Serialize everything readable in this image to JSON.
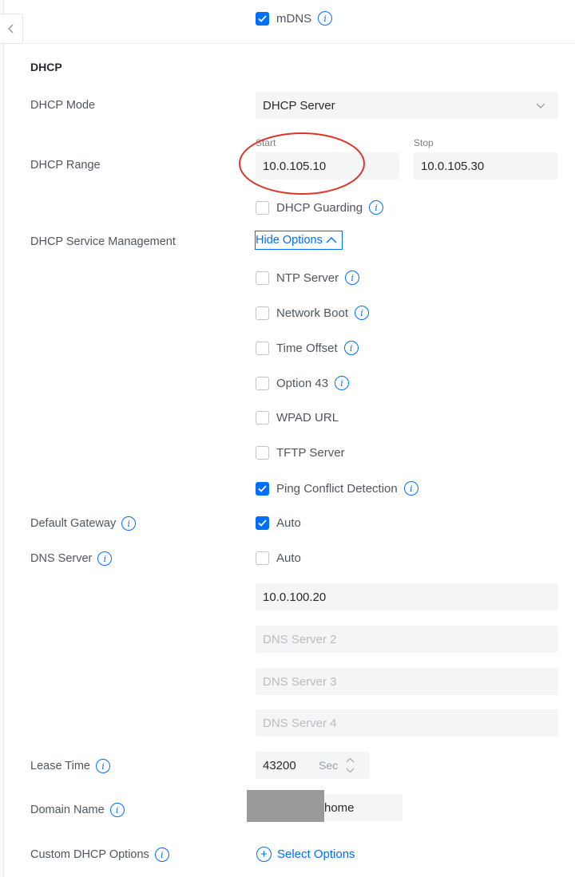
{
  "mdns": {
    "label": "mDNS",
    "checked": true
  },
  "section_title": "DHCP",
  "dhcp_mode": {
    "label": "DHCP Mode",
    "value": "DHCP Server"
  },
  "dhcp_range": {
    "label": "DHCP Range",
    "start_label": "Start",
    "start_value": "10.0.105.10",
    "stop_label": "Stop",
    "stop_value": "10.0.105.30"
  },
  "dhcp_guarding": {
    "label": "DHCP Guarding",
    "checked": false
  },
  "service_mgmt": {
    "label": "DHCP Service Management",
    "toggle_label": "Hide Options",
    "options": [
      {
        "label": "NTP Server",
        "checked": false,
        "info": true
      },
      {
        "label": "Network Boot",
        "checked": false,
        "info": true
      },
      {
        "label": "Time Offset",
        "checked": false,
        "info": true
      },
      {
        "label": "Option 43",
        "checked": false,
        "info": true
      },
      {
        "label": "WPAD URL",
        "checked": false,
        "info": false
      },
      {
        "label": "TFTP Server",
        "checked": false,
        "info": false
      },
      {
        "label": "Ping Conflict Detection",
        "checked": true,
        "info": true
      }
    ]
  },
  "default_gateway": {
    "label": "Default Gateway",
    "auto_label": "Auto",
    "auto_checked": true
  },
  "dns_server": {
    "label": "DNS Server",
    "auto_label": "Auto",
    "auto_checked": false,
    "server1_value": "10.0.100.20",
    "server2_placeholder": "DNS Server 2",
    "server3_placeholder": "DNS Server 3",
    "server4_placeholder": "DNS Server 4"
  },
  "lease_time": {
    "label": "Lease Time",
    "value": "43200",
    "unit": "Sec"
  },
  "domain_name": {
    "label": "Domain Name",
    "value": "home"
  },
  "custom_dhcp": {
    "label": "Custom DHCP Options",
    "action_label": "Select Options"
  },
  "colors": {
    "accent": "#006fff",
    "annotation": "#e0352b",
    "redaction": "#999999"
  },
  "icons": {
    "back": "chevron-left-icon",
    "info": "info-icon",
    "check": "check-icon",
    "dropdown": "chevron-down-icon",
    "collapse": "chevron-up-icon",
    "add": "plus-circle-icon"
  }
}
